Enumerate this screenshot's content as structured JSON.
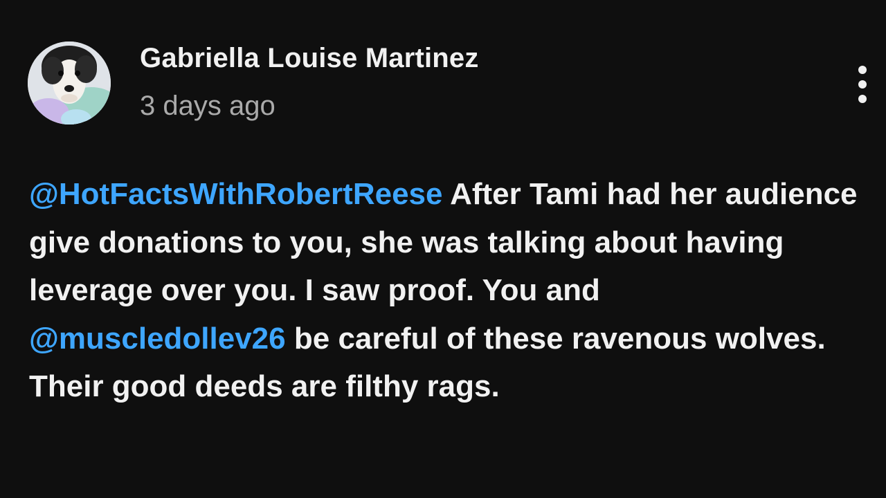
{
  "comment": {
    "author": "Gabriella Louise Martinez",
    "timestamp": "3 days ago",
    "more_icon": "more-vertical-icon",
    "avatar_icon": "dog-photo-avatar",
    "body": {
      "mention_1": "@HotFactsWithRobertReese",
      "text_1": " After Tami had her audience give donations to you,  she was talking about having leverage over you. I saw proof. You and ",
      "mention_2": "@muscledollev26",
      "text_2": " be careful of these ravenous wolves. Their good deeds are filthy rags."
    }
  },
  "colors": {
    "background": "#0f0f0f",
    "text": "#f1f1f1",
    "secondary_text": "#aaaaaa",
    "mention": "#3ea6ff"
  }
}
